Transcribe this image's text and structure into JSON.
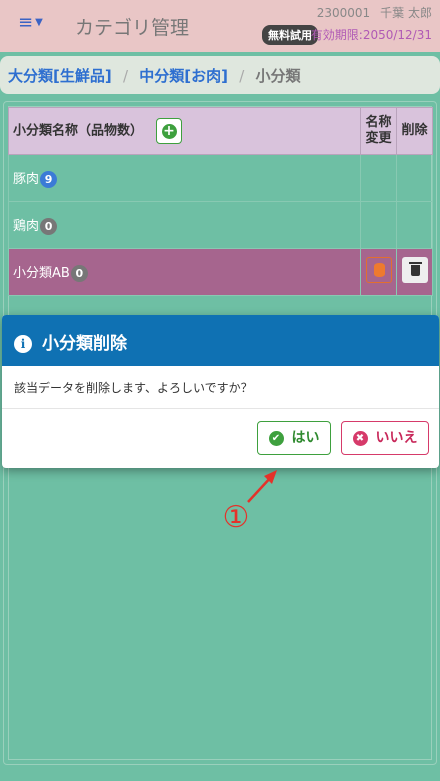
{
  "header": {
    "menu_icon": "hamburger-icon",
    "title": "カテゴリ管理",
    "user_id": "2300001",
    "user_name": "千葉 太郎",
    "trial_badge": "無料試用",
    "expiry": "有効期限:2050/12/31"
  },
  "breadcrumb": {
    "items": [
      "大分類[生鮮品]",
      "中分類[お肉]",
      "小分類"
    ],
    "separator": "/"
  },
  "table": {
    "headers": {
      "name": "小分類名称（品物数）",
      "rename_line1": "名称",
      "rename_line2": "変更",
      "delete": "削除"
    },
    "rows": [
      {
        "name": "豚肉",
        "count": "9",
        "badge_color": "#3b7bd6"
      },
      {
        "name": "鶏肉",
        "count": "0",
        "badge_color": "#777777"
      },
      {
        "name": "小分類AB",
        "count": "0",
        "badge_color": "#777777",
        "selected": true
      }
    ]
  },
  "dialog": {
    "title": "小分類削除",
    "message": "該当データを削除します、よろしいですか？",
    "yes_label": "はい",
    "no_label": "いいえ"
  },
  "annotation": {
    "number": "①",
    "color": "#e4322a"
  },
  "colors": {
    "header_bg": "#e9c6c6",
    "page_bg": "#6ebfa4",
    "dialog_header": "#0f71b3",
    "selected_row": "#a6658e",
    "yes": "#3ea03e",
    "no": "#d63a6a"
  }
}
